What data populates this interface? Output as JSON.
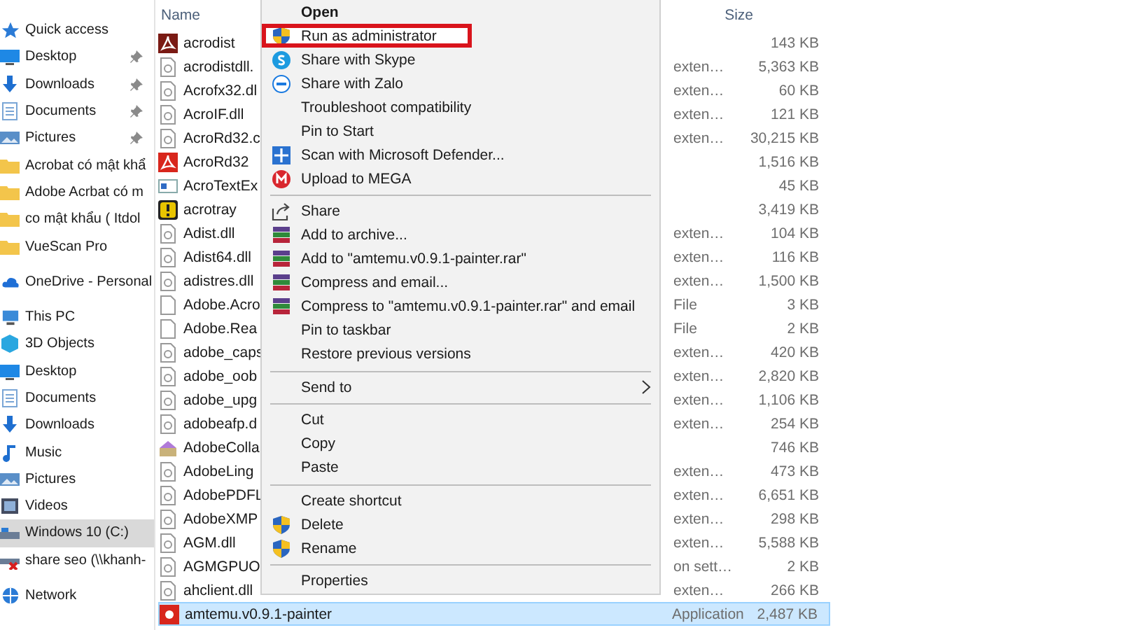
{
  "sidebar": {
    "items": [
      {
        "label": "Quick access",
        "kind": "star",
        "selected": false,
        "children": [
          {
            "label": "Desktop",
            "kind": "desktop",
            "pinned": true,
            "selected": false
          },
          {
            "label": "Downloads",
            "kind": "download",
            "pinned": true,
            "selected": false
          },
          {
            "label": "Documents",
            "kind": "document",
            "pinned": true,
            "selected": false
          },
          {
            "label": "Pictures",
            "kind": "pictures",
            "pinned": true,
            "selected": false
          },
          {
            "label": "Acrobat có mật khẩ",
            "kind": "folder",
            "pinned": false,
            "selected": false
          },
          {
            "label": "Adobe Acrbat có m",
            "kind": "folder",
            "pinned": false,
            "selected": false
          },
          {
            "label": "co mật khẩu ( Itdol",
            "kind": "folder",
            "pinned": false,
            "selected": false
          },
          {
            "label": "VueScan Pro",
            "kind": "folder",
            "pinned": false,
            "selected": false
          }
        ]
      },
      {
        "label": "OneDrive - Personal",
        "kind": "cloud",
        "selected": false
      },
      {
        "label": "This PC",
        "kind": "pc",
        "selected": false,
        "children": [
          {
            "label": "3D Objects",
            "kind": "cube",
            "pinned": false,
            "selected": false
          },
          {
            "label": "Desktop",
            "kind": "desktop",
            "pinned": false,
            "selected": false
          },
          {
            "label": "Documents",
            "kind": "document",
            "pinned": false,
            "selected": false
          },
          {
            "label": "Downloads",
            "kind": "download",
            "pinned": false,
            "selected": false
          },
          {
            "label": "Music",
            "kind": "music",
            "pinned": false,
            "selected": false
          },
          {
            "label": "Pictures",
            "kind": "pictures",
            "pinned": false,
            "selected": false
          },
          {
            "label": "Videos",
            "kind": "video",
            "pinned": false,
            "selected": false
          },
          {
            "label": "Windows 10 (C:)",
            "kind": "drive",
            "pinned": false,
            "selected": true
          },
          {
            "label": "share seo (\\\\khanh-",
            "kind": "netdrive",
            "pinned": false,
            "selected": false
          }
        ]
      },
      {
        "label": "Network",
        "kind": "network",
        "selected": false
      }
    ]
  },
  "file_list": {
    "columns": [
      "Name",
      "Size"
    ],
    "files": [
      {
        "name": "acrodist",
        "kind": "pdfdark",
        "size": "143 KB",
        "selected": false
      },
      {
        "name": "acrodistdll.",
        "kind": "dll",
        "type": "exten…",
        "size": "5,363 KB",
        "selected": false
      },
      {
        "name": "Acrofx32.dl",
        "kind": "dll",
        "type": "exten…",
        "size": "60 KB",
        "selected": false
      },
      {
        "name": "AcroIF.dll",
        "kind": "dll",
        "type": "exten…",
        "size": "121 KB",
        "selected": false
      },
      {
        "name": "AcroRd32.c",
        "kind": "dll",
        "type": "exten…",
        "size": "30,215 KB",
        "selected": false
      },
      {
        "name": "AcroRd32",
        "kind": "pdf",
        "size": "1,516 KB",
        "selected": false
      },
      {
        "name": "AcroTextEx",
        "kind": "app",
        "size": "45 KB",
        "selected": false
      },
      {
        "name": "acrotray",
        "kind": "warning",
        "size": "3,419 KB",
        "selected": false
      },
      {
        "name": "Adist.dll",
        "kind": "dll",
        "type": "exten…",
        "size": "104 KB",
        "selected": false
      },
      {
        "name": "Adist64.dll",
        "kind": "dll",
        "type": "exten…",
        "size": "116 KB",
        "selected": false
      },
      {
        "name": "adistres.dll",
        "kind": "dll",
        "type": "exten…",
        "size": "1,500 KB",
        "selected": false
      },
      {
        "name": "Adobe.Acro",
        "kind": "blank",
        "type": "File",
        "size": "3 KB",
        "selected": false
      },
      {
        "name": "Adobe.Rea",
        "kind": "blank",
        "type": "File",
        "size": "2 KB",
        "selected": false
      },
      {
        "name": "adobe_caps",
        "kind": "dll",
        "type": "exten…",
        "size": "420 KB",
        "selected": false
      },
      {
        "name": "adobe_oob",
        "kind": "dll",
        "type": "exten…",
        "size": "2,820 KB",
        "selected": false
      },
      {
        "name": "adobe_upg",
        "kind": "dll",
        "type": "exten…",
        "size": "1,106 KB",
        "selected": false
      },
      {
        "name": "adobeafp.d",
        "kind": "dll",
        "type": "exten…",
        "size": "254 KB",
        "selected": false
      },
      {
        "name": "AdobeColla",
        "kind": "installer",
        "size": "746 KB",
        "selected": false
      },
      {
        "name": "AdobeLing",
        "kind": "dll",
        "type": "exten…",
        "size": "473 KB",
        "selected": false
      },
      {
        "name": "AdobePDFL",
        "kind": "dll",
        "type": "exten…",
        "size": "6,651 KB",
        "selected": false
      },
      {
        "name": "AdobeXMP",
        "kind": "dll",
        "type": "exten…",
        "size": "298 KB",
        "selected": false
      },
      {
        "name": "AGM.dll",
        "kind": "dll",
        "type": "exten…",
        "size": "5,588 KB",
        "selected": false
      },
      {
        "name": "AGMGPUO",
        "kind": "settings",
        "type": "on sett…",
        "size": "2 KB",
        "selected": false
      },
      {
        "name": "ahclient.dll",
        "kind": "dll",
        "type": "exten…",
        "size": "266 KB",
        "selected": false
      },
      {
        "name": "amtemu.v0.9.1-painter",
        "kind": "app",
        "type": "Application",
        "size": "2,487 KB",
        "selected": true
      }
    ]
  },
  "context_menu": {
    "items": [
      {
        "kind": "item",
        "label": "Open",
        "bold": true,
        "selected": false,
        "submenu": false
      },
      {
        "kind": "item",
        "label": "Run as administrator",
        "bold": false,
        "selected": true,
        "submenu": false
      },
      {
        "kind": "item",
        "label": "Share with Skype",
        "bold": false,
        "selected": false,
        "submenu": false
      },
      {
        "kind": "item",
        "label": "Share with Zalo",
        "bold": false,
        "selected": false,
        "submenu": false
      },
      {
        "kind": "item",
        "label": "Troubleshoot compatibility",
        "bold": false,
        "selected": false,
        "submenu": false
      },
      {
        "kind": "item",
        "label": "Pin to Start",
        "bold": false,
        "selected": false,
        "submenu": false
      },
      {
        "kind": "item",
        "label": "Scan with Microsoft Defender...",
        "bold": false,
        "selected": false,
        "submenu": false
      },
      {
        "kind": "item",
        "label": "Upload to MEGA",
        "bold": false,
        "selected": false,
        "submenu": false
      },
      {
        "kind": "separator"
      },
      {
        "kind": "item",
        "label": "Share",
        "bold": false,
        "selected": false,
        "submenu": false
      },
      {
        "kind": "item",
        "label": "Add to archive...",
        "bold": false,
        "selected": false,
        "submenu": false
      },
      {
        "kind": "item",
        "label": "Add to \"amtemu.v0.9.1-painter.rar\"",
        "bold": false,
        "selected": false,
        "submenu": false
      },
      {
        "kind": "item",
        "label": "Compress and email...",
        "bold": false,
        "selected": false,
        "submenu": false
      },
      {
        "kind": "item",
        "label": "Compress to \"amtemu.v0.9.1-painter.rar\" and email",
        "bold": false,
        "selected": false,
        "submenu": false
      },
      {
        "kind": "item",
        "label": "Pin to taskbar",
        "bold": false,
        "selected": false,
        "submenu": false
      },
      {
        "kind": "item",
        "label": "Restore previous versions",
        "bold": false,
        "selected": false,
        "submenu": false
      },
      {
        "kind": "separator"
      },
      {
        "kind": "item",
        "label": "Send to",
        "bold": false,
        "selected": false,
        "submenu": true
      },
      {
        "kind": "separator"
      },
      {
        "kind": "item",
        "label": "Cut",
        "bold": false,
        "selected": false,
        "submenu": false
      },
      {
        "kind": "item",
        "label": "Copy",
        "bold": false,
        "selected": false,
        "submenu": false
      },
      {
        "kind": "item",
        "label": "Paste",
        "bold": false,
        "selected": false,
        "submenu": false
      },
      {
        "kind": "separator"
      },
      {
        "kind": "item",
        "label": "Create shortcut",
        "bold": false,
        "selected": false,
        "submenu": false
      },
      {
        "kind": "item",
        "label": "Delete",
        "bold": false,
        "selected": false,
        "submenu": false
      },
      {
        "kind": "item",
        "label": "Rename",
        "bold": false,
        "selected": false,
        "submenu": false
      },
      {
        "kind": "separator"
      },
      {
        "kind": "item",
        "label": "Properties",
        "bold": false,
        "selected": false,
        "submenu": false
      }
    ]
  }
}
